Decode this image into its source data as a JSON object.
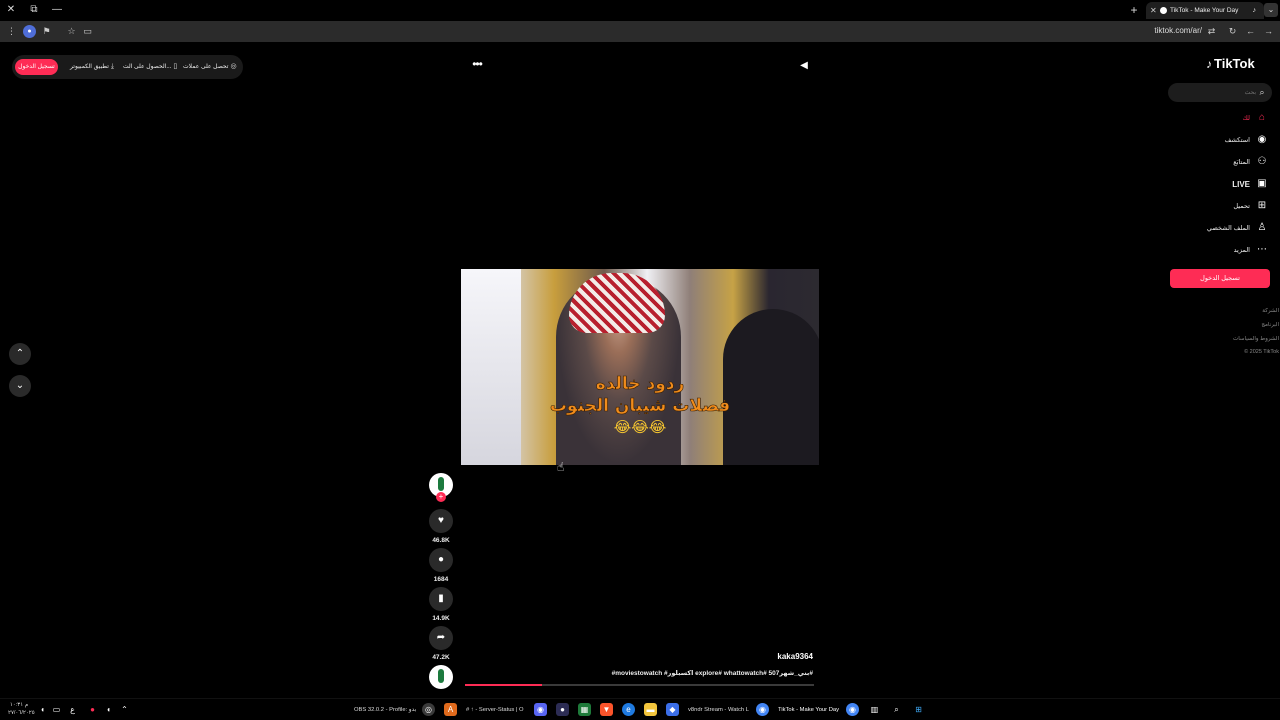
{
  "browser": {
    "tab_title": "TikTok - Make Your Day",
    "url": "tiktok.com/ar/",
    "icons": [
      "close-icon",
      "restore-icon",
      "minimize-icon",
      "new-tab-icon",
      "tab-menu-icon",
      "menu-icon",
      "profile-icon",
      "extension-icon",
      "star-icon",
      "cast-icon",
      "reload-icon",
      "back-icon",
      "forward-icon"
    ]
  },
  "header": {
    "login_label": "تسجيل الدخول",
    "links": [
      {
        "label": "تطبيق الكمبيوتر",
        "icon": "download-icon"
      },
      {
        "label": "الحصول على الت...",
        "icon": "phone-icon"
      },
      {
        "label": "تحصل على عملات",
        "icon": "coin-icon"
      }
    ]
  },
  "video": {
    "caption_line1": "ردود خالده",
    "caption_line2": "فصلات شيبان الجنوب",
    "caption_line3": "😂😂😂",
    "author": "kaka9364",
    "description": "#moviestowatch #اكسبلور explore# whattowatch# بني_شهر507#",
    "progress": 0.22
  },
  "actions": {
    "likes": "46.8K",
    "comments": "1684",
    "bookmarks": "14.9K",
    "shares": "47.2K"
  },
  "sidebar": {
    "logo": "TikTok",
    "search_placeholder": "بحث",
    "items": [
      {
        "label": "لك",
        "icon": "home-icon",
        "active": true
      },
      {
        "label": "استكشف",
        "icon": "compass-icon"
      },
      {
        "label": "المتابَع",
        "icon": "following-icon"
      },
      {
        "label": "LIVE",
        "icon": "live-icon"
      },
      {
        "label": "تحميل",
        "icon": "upload-icon"
      },
      {
        "label": "الملف الشخصي",
        "icon": "profile-icon"
      },
      {
        "label": "المزيد",
        "icon": "more-icon"
      }
    ],
    "login_label": "تسجيل الدخول",
    "footer": [
      "الشركة",
      "البرنامج",
      "الشروط والسياسات",
      "© 2025 TikTok"
    ]
  },
  "taskbar": {
    "clock_time": "م ١٠:٣١",
    "clock_date": "٢٧/٠٦/٢٠٢٥",
    "obs": "OBS 32.0.2 - Profile: بدو",
    "server_status": "# ↑ - Server-Status | O",
    "stream": "v8ndr Stream - Watch L",
    "tiktok": "TikTok - Make Your Day"
  },
  "colors": {
    "accent": "#fe2c55",
    "background": "#000000",
    "chrome": "#2b2b2b"
  }
}
